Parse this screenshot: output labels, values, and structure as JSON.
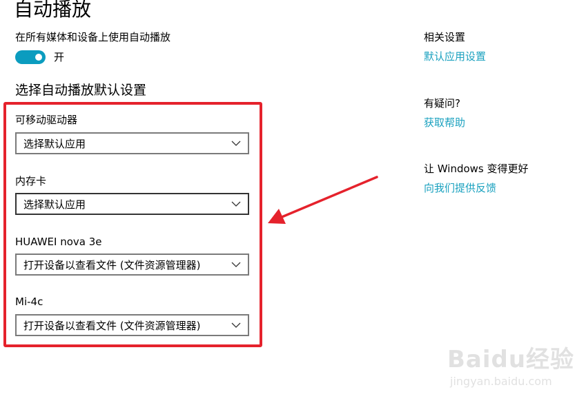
{
  "page": {
    "title": "自动播放"
  },
  "autoplay": {
    "label": "在所有媒体和设备上使用自动播放",
    "toggle_state": "开",
    "toggle_on": true,
    "accent_color": "#0b9cbf"
  },
  "defaults": {
    "section_title": "选择自动播放默认设置",
    "devices": [
      {
        "label": "可移动驱动器",
        "selected": "选择默认应用"
      },
      {
        "label": "内存卡",
        "selected": "选择默认应用"
      },
      {
        "label": "HUAWEI nova 3e",
        "selected": "打开设备以查看文件 (文件资源管理器)"
      },
      {
        "label": "Mi-4c",
        "selected": "打开设备以查看文件 (文件资源管理器)"
      }
    ]
  },
  "sidebar": {
    "related_heading": "相关设置",
    "related_link": "默认应用设置",
    "question_heading": "有疑问?",
    "question_link": "获取帮助",
    "feedback_heading": "让 Windows 变得更好",
    "feedback_link": "向我们提供反馈",
    "link_color": "#1aa1bf"
  },
  "annotation": {
    "highlight_color": "#e5222c"
  },
  "watermark": {
    "brand": "Baidu经验",
    "url": "jingyan.baidu.com"
  },
  "icons": {
    "dropdown": "chevron-down-icon",
    "annotation_arrow": "arrow-icon"
  }
}
